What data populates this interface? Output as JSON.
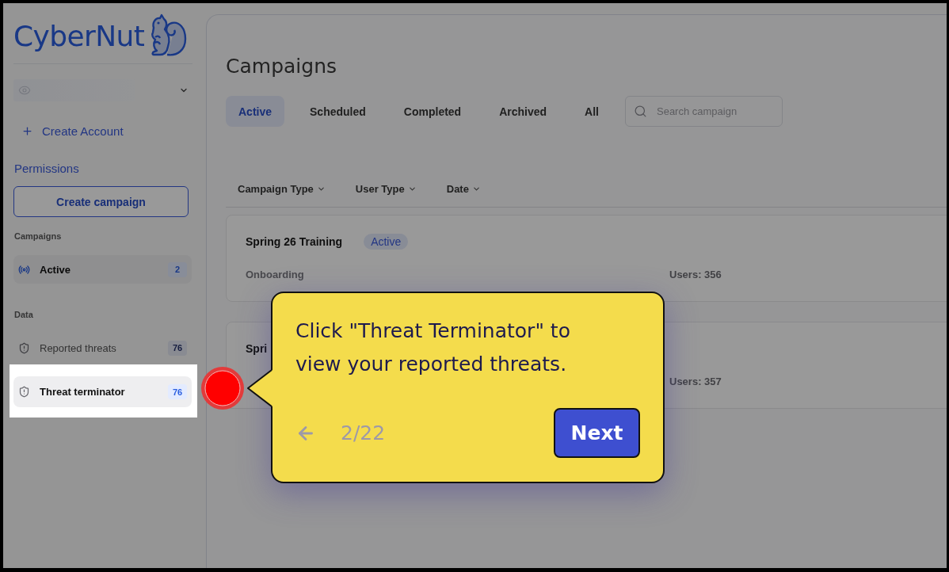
{
  "sidebar": {
    "logo": "CyberNut",
    "links": [
      {
        "kind": "create",
        "label": "Create Account"
      },
      {
        "kind": "plain",
        "label": "Permissions"
      }
    ],
    "create_button": "Create campaign",
    "sections": [
      {
        "title": "Campaigns",
        "items": [
          {
            "kind": "campaign",
            "label": "Active",
            "count": "2",
            "selected": true,
            "tour_target": false
          }
        ]
      },
      {
        "title": "Data",
        "items": [
          {
            "kind": "threat",
            "label": "Reported threats",
            "count": "76",
            "selected": false,
            "tour_target": false
          },
          {
            "kind": "threat",
            "label": "Threat terminator",
            "count": "76",
            "selected": true,
            "tour_target": true
          }
        ]
      }
    ]
  },
  "main": {
    "title": "Campaigns",
    "tabs": [
      {
        "label": "Active",
        "selected": true
      },
      {
        "label": "Scheduled",
        "selected": false
      },
      {
        "label": "Completed",
        "selected": false
      },
      {
        "label": "Archived",
        "selected": false
      },
      {
        "label": "All",
        "selected": false
      }
    ],
    "search": {
      "placeholder": "Search campaign"
    },
    "filters": [
      "Campaign Type",
      "User Type",
      "Date"
    ],
    "campaigns": [
      {
        "name": "Spring 26 Training",
        "status": "Active",
        "type": "Onboarding",
        "users": "Users: 356"
      },
      {
        "name": "Spri",
        "users": "Users: 357"
      }
    ]
  },
  "tour": {
    "message": "Click \"Threat Terminator\" to view your reported threats.",
    "step": "2/22",
    "next": "Next"
  }
}
